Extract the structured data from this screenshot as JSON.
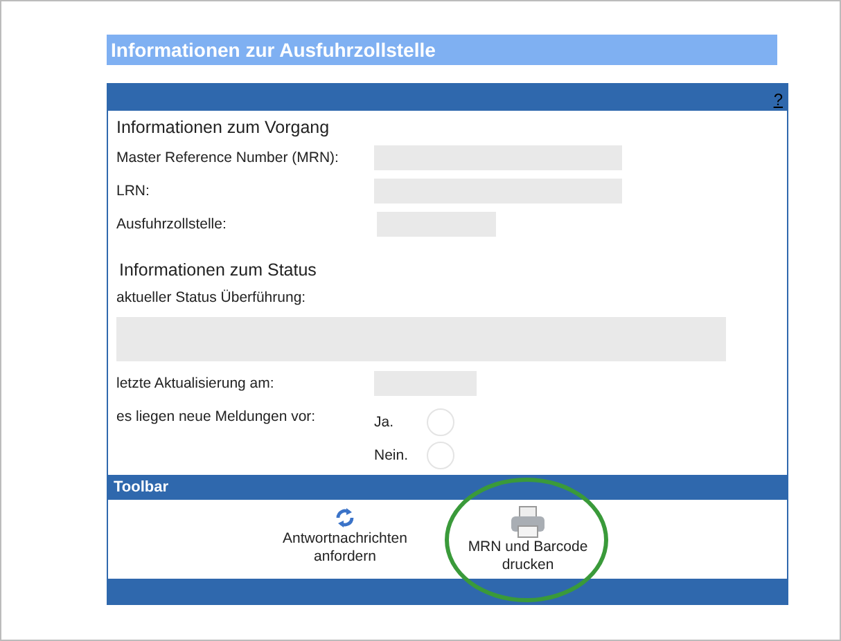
{
  "title": "Informationen zur Ausfuhrzollstelle",
  "help": "?",
  "sections": [
    {
      "heading": "Informationen zum Vorgang",
      "fields": [
        {
          "label": "Master Reference Number (MRN):",
          "kind": "wide"
        },
        {
          "label": "LRN:",
          "kind": "wide"
        },
        {
          "label": "Ausfuhrzollstelle:",
          "kind": "short"
        }
      ]
    },
    {
      "heading": "Informationen zum Status"
    }
  ],
  "status_label": "aktueller Status Überführung:",
  "update_label": "letzte Aktualisierung am:",
  "messages": {
    "label": "es liegen neue Meldungen vor:",
    "options": [
      {
        "label": "Ja.",
        "selected": false
      },
      {
        "label": "Nein.",
        "selected": false
      }
    ]
  },
  "toolbar": {
    "title": "Toolbar",
    "buttons": [
      {
        "kind": "refresh",
        "label": "Antwortnachrichten anfordern",
        "highlighted": false
      },
      {
        "kind": "print",
        "label": "MRN und Barcode drucken",
        "highlighted": true
      }
    ]
  }
}
